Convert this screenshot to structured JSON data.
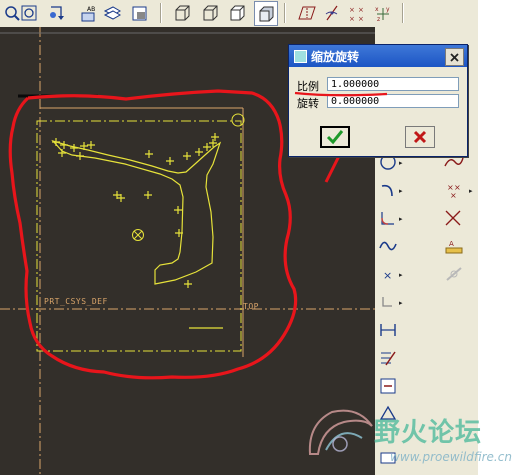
{
  "toolbar": {
    "buttons": [
      {
        "icon": "zoom-in-icon"
      },
      {
        "icon": "zoom-fit-icon"
      },
      {
        "icon": "reorient-icon"
      },
      {
        "icon": "saved-view-icon"
      },
      {
        "icon": "layers-icon"
      },
      {
        "icon": "view-manager-icon"
      },
      {
        "icon": "wireframe-icon"
      },
      {
        "icon": "hidden-line-icon"
      },
      {
        "icon": "no-hidden-icon"
      },
      {
        "icon": "shading-icon"
      },
      {
        "icon": "datum-planes-icon"
      },
      {
        "icon": "datum-axes-icon"
      },
      {
        "icon": "datum-points-icon"
      },
      {
        "icon": "coordinate-systems-icon"
      }
    ]
  },
  "canvas": {
    "background": "#332f2a",
    "sketch_color": "#e6e23a",
    "datum_color": "#d8a46a",
    "markup_color": "#e8151b",
    "datum_labels": {
      "csys": "PRT_CSYS_DEF",
      "plane": "TOP"
    }
  },
  "dialog": {
    "title": "缩放旋转",
    "scale_label": "比例",
    "scale_value": "1.000000",
    "rotate_label": "旋转",
    "rotate_value": "0.000000",
    "ok_icon": "checkmark-icon",
    "cancel_icon": "x-cancel-icon",
    "close_icon": "close-icon"
  },
  "sketch_tools": [
    {
      "icon": "circle-icon"
    },
    {
      "icon": "spline-icon"
    },
    {
      "icon": "arc-icon"
    },
    {
      "icon": "point-icon"
    },
    {
      "icon": "fillet-icon"
    },
    {
      "icon": "trim-icon"
    },
    {
      "icon": "sine-icon"
    },
    {
      "icon": "text-icon"
    },
    {
      "icon": "x-point-icon"
    },
    {
      "icon": "mirror-icon"
    },
    {
      "icon": "line-icon"
    },
    {
      "icon": "constraint-icon"
    },
    {
      "icon": "dimension-icon"
    },
    {
      "icon": "modify-icon"
    },
    {
      "icon": "palette-icon"
    }
  ],
  "watermark": {
    "brand": "野火论坛",
    "url": "www.proewildfire.cn"
  }
}
